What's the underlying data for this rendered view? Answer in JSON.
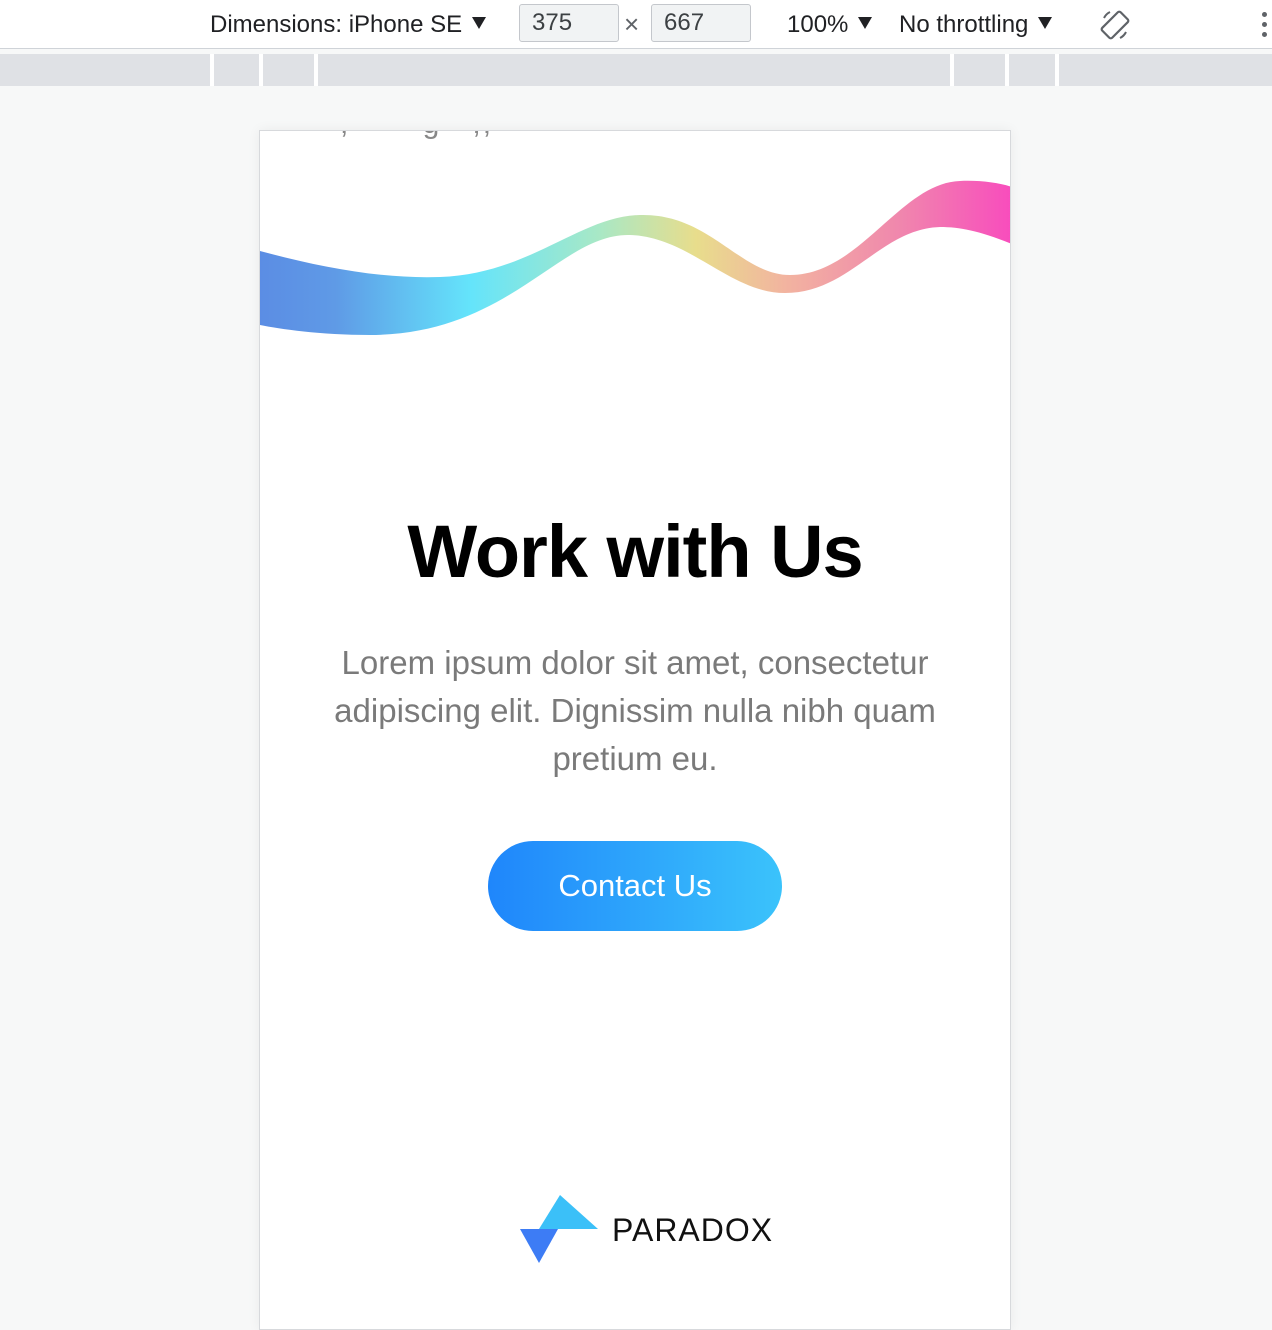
{
  "devtools": {
    "device_label": "Dimensions: iPhone SE",
    "width_value": "375",
    "height_value": "667",
    "times_symbol": "×",
    "zoom_label": "100%",
    "throttling_label": "No throttling",
    "rotate_icon": "rotate-device-icon",
    "more_icon": "more-options-icon"
  },
  "page": {
    "hero": {
      "title": "Work with Us",
      "text": "Lorem ipsum dolor sit amet, consectetur adipiscing elit. Dignissim nulla nibh quam pretium eu.",
      "button_label": "Contact Us"
    },
    "footer": {
      "brand": "PARADOX"
    }
  },
  "colors": {
    "button_gradient_start": "#1f86fb",
    "button_gradient_end": "#3bc3fb",
    "wave_colors": [
      "#5b8de4",
      "#64e4fb",
      "#e8dd8c",
      "#f2a4a0",
      "#f84cbd"
    ],
    "logo_dark": "#3d7cf5",
    "logo_light": "#3bc0f8"
  }
}
